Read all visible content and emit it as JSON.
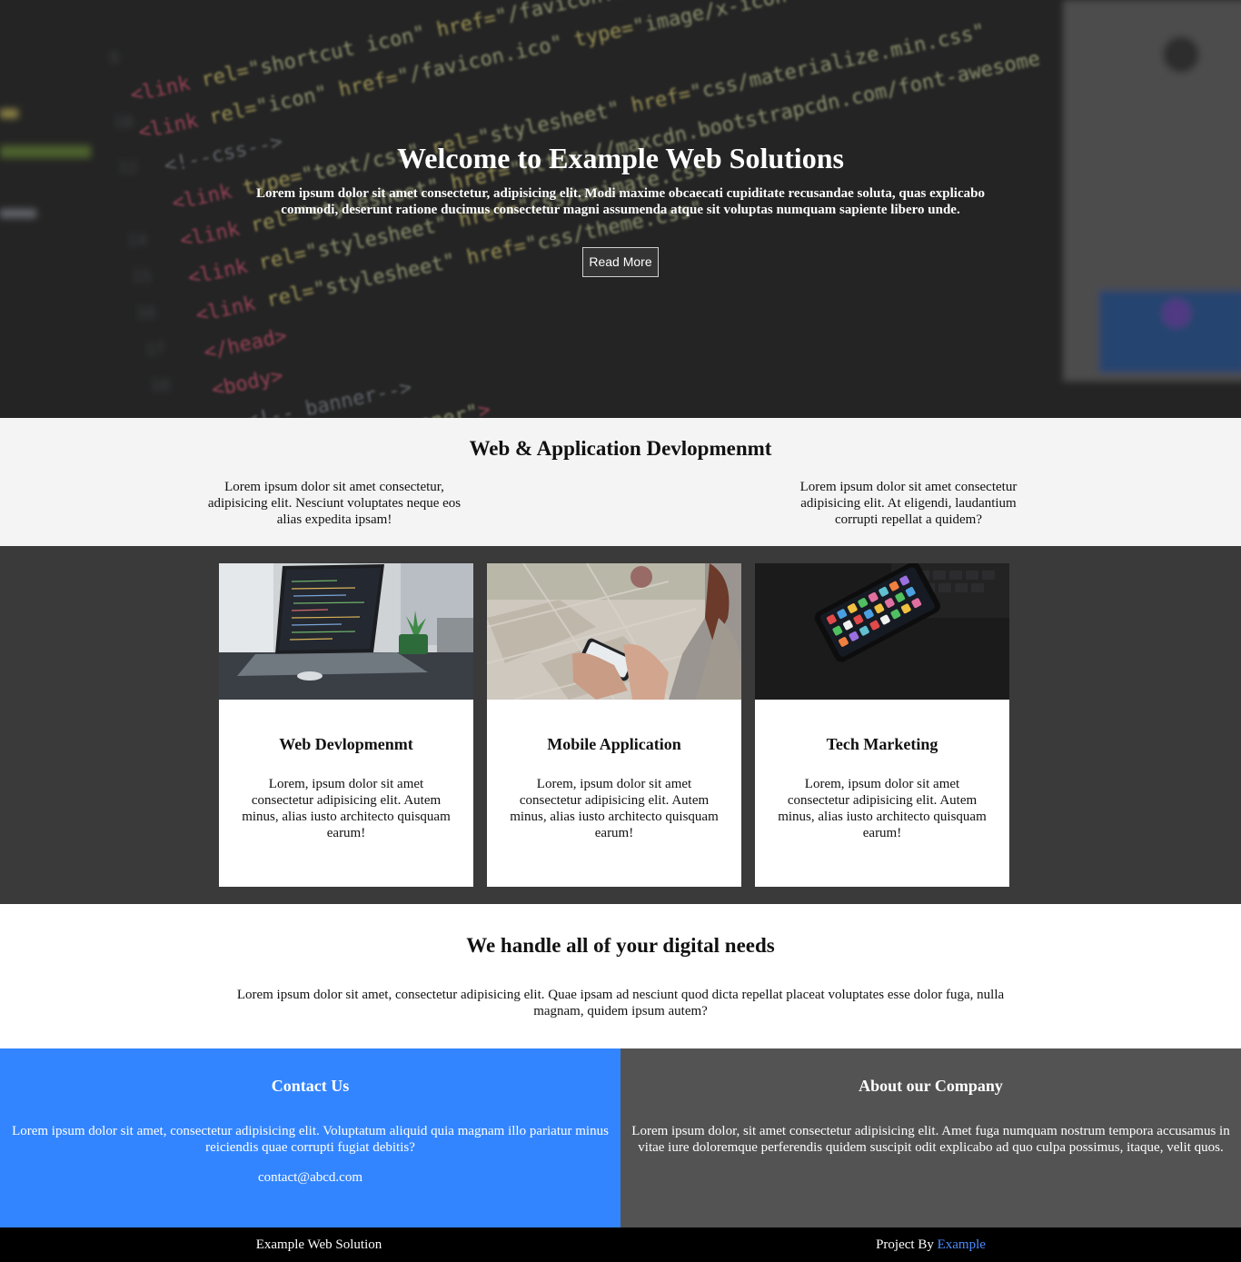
{
  "hero": {
    "title": "Welcome to Example Web Solutions",
    "text": "Lorem ipsum dolor sit amet consectetur, adipisicing elit. Modi maxime obcaecati cupiditate recusandae soluta, quas explicabo commodi, deserunt ratione ducimus consectetur magni assumenda atque sit voluptas numquam sapiente libero unde.",
    "button_label": "Read More"
  },
  "intro": {
    "title": "Web & Application Devlopmenmt",
    "left_text": "Lorem ipsum dolor sit amet consectetur, adipisicing elit. Nesciunt voluptates neque eos alias expedita ipsam!",
    "right_text": "Lorem ipsum dolor sit amet consectetur adipisicing elit. At eligendi, laudantium corrupti repellat a quidem?"
  },
  "services": [
    {
      "title": "Web Devlopmenmt",
      "text": "Lorem, ipsum dolor sit amet consectetur adipisicing elit. Autem minus, alias iusto architecto quisquam earum!",
      "image": "laptop-code-photo"
    },
    {
      "title": "Mobile Application",
      "text": "Lorem, ipsum dolor sit amet consectetur adipisicing elit. Autem minus, alias iusto architecto quisquam earum!",
      "image": "phone-in-hand-photo"
    },
    {
      "title": "Tech Marketing",
      "text": "Lorem, ipsum dolor sit amet consectetur adipisicing elit. Autem minus, alias iusto architecto quisquam earum!",
      "image": "smartphone-apps-photo"
    }
  ],
  "digital": {
    "title": "We handle all of your digital needs",
    "text": "Lorem ipsum dolor sit amet, consectetur adipisicing elit. Quae ipsam ad nesciunt quod dicta repellat placeat voluptates esse dolor fuga, nulla magnam, quidem ipsum autem?"
  },
  "contact": {
    "title": "Contact Us",
    "text": "Lorem ipsum dolor sit amet, consectetur adipisicing elit. Voluptatum aliquid quia magnam illo pariatur minus reiciendis quae corrupti fugiat debitis?",
    "email": "contact@abcd.com"
  },
  "about": {
    "title": "About our Company",
    "text": "Lorem ipsum dolor, sit amet consectetur adipisicing elit. Amet fuga numquam nostrum tempora accusamus in vitae iure doloremque perferendis quidem suscipit odit explicabo ad quo culpa possimus, itaque, velit quos."
  },
  "footer": {
    "brand": "Example Web Solution",
    "credit_prefix": "Project By",
    "credit_link": "Example"
  },
  "colors": {
    "contact_bg": "#3385ff",
    "about_bg": "#535353",
    "services_bg": "#3a3a3a",
    "intro_bg": "#f4f4f4",
    "link": "#4d8cff"
  }
}
